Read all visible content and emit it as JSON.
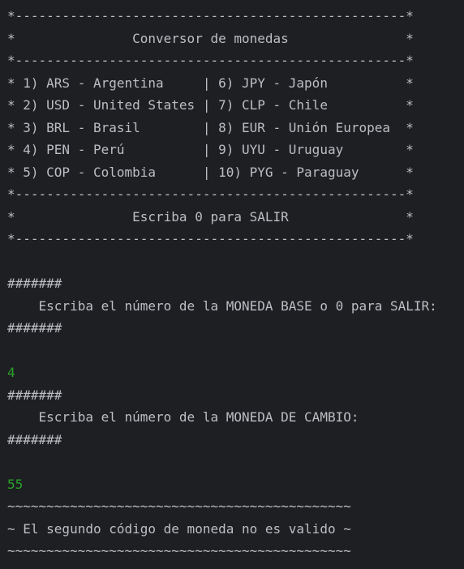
{
  "console": {
    "lines": [
      {
        "text": "*--------------------------------------------------*",
        "kind": "output"
      },
      {
        "text": "*               Conversor de monedas               *",
        "kind": "output"
      },
      {
        "text": "*--------------------------------------------------*",
        "kind": "output"
      },
      {
        "text": "* 1) ARS - Argentina     | 6) JPY - Japón          *",
        "kind": "output"
      },
      {
        "text": "* 2) USD - United States | 7) CLP - Chile          *",
        "kind": "output"
      },
      {
        "text": "* 3) BRL - Brasil        | 8) EUR - Unión Europea  *",
        "kind": "output"
      },
      {
        "text": "* 4) PEN - Perú          | 9) UYU - Uruguay        *",
        "kind": "output"
      },
      {
        "text": "* 5) COP - Colombia      | 10) PYG - Paraguay      *",
        "kind": "output"
      },
      {
        "text": "*--------------------------------------------------*",
        "kind": "output"
      },
      {
        "text": "*               Escriba 0 para SALIR               *",
        "kind": "output"
      },
      {
        "text": "*--------------------------------------------------*",
        "kind": "output"
      },
      {
        "text": "",
        "kind": "output"
      },
      {
        "text": "#######",
        "kind": "output"
      },
      {
        "text": "    Escriba el número de la MONEDA BASE o 0 para SALIR:",
        "kind": "output"
      },
      {
        "text": "#######",
        "kind": "output"
      },
      {
        "text": "",
        "kind": "output"
      },
      {
        "text": "4",
        "kind": "input"
      },
      {
        "text": "#######",
        "kind": "output"
      },
      {
        "text": "    Escriba el número de la MONEDA DE CAMBIO:",
        "kind": "output"
      },
      {
        "text": "#######",
        "kind": "output"
      },
      {
        "text": "",
        "kind": "output"
      },
      {
        "text": "55",
        "kind": "input"
      },
      {
        "text": "~~~~~~~~~~~~~~~~~~~~~~~~~~~~~~~~~~~~~~~~~~~~",
        "kind": "output"
      },
      {
        "text": "~ El segundo código de moneda no es valido ~",
        "kind": "output"
      },
      {
        "text": "~~~~~~~~~~~~~~~~~~~~~~~~~~~~~~~~~~~~~~~~~~~~",
        "kind": "output"
      }
    ]
  },
  "colors": {
    "background": "#1e1f22",
    "output_text": "#bcbec4",
    "input_text": "#29a329"
  }
}
